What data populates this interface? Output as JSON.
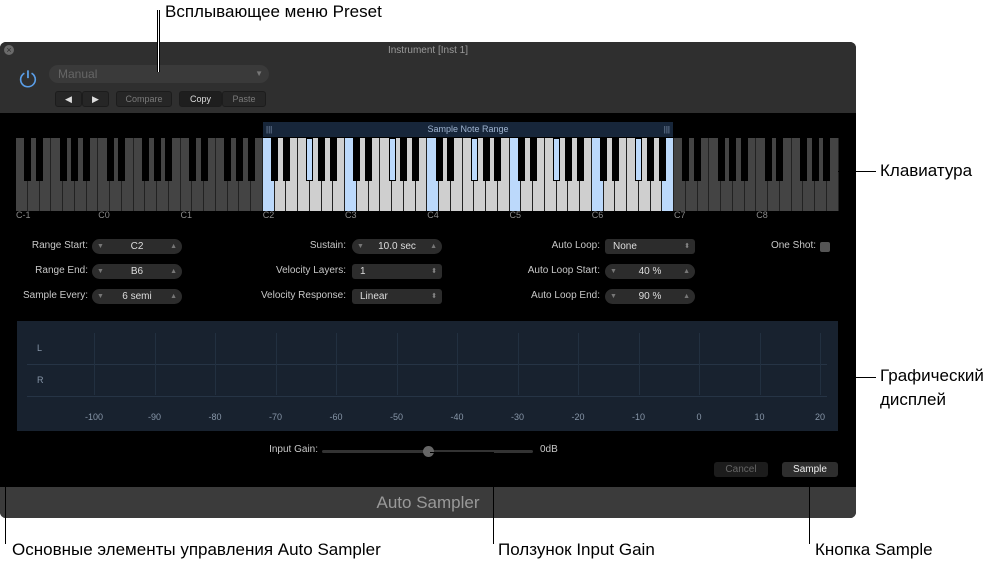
{
  "window": {
    "title": "Instrument [Inst 1]",
    "footer": "Auto Sampler"
  },
  "toolbar": {
    "preset": "Manual",
    "prev": "◀",
    "next": "▶",
    "compare": "Compare",
    "copy": "Copy",
    "paste": "Paste"
  },
  "keyboard": {
    "range_label": "Sample Note Range",
    "octaves": [
      "C-1",
      "C0",
      "C1",
      "C2",
      "C3",
      "C4",
      "C5",
      "C6",
      "C7",
      "C8"
    ],
    "highlighted_notes": [
      "C2",
      "F#2",
      "C3",
      "F#3",
      "C4",
      "F#4",
      "C5",
      "F#5",
      "C6",
      "F#6",
      "B6"
    ],
    "highlight_color": "#bcd9fb"
  },
  "controls": {
    "range_start": {
      "label": "Range Start:",
      "value": "C2"
    },
    "range_end": {
      "label": "Range End:",
      "value": "B6"
    },
    "sample_every": {
      "label": "Sample Every:",
      "value": "6 semi"
    },
    "sustain": {
      "label": "Sustain:",
      "value": "10.0 sec"
    },
    "velocity_layers": {
      "label": "Velocity Layers:",
      "value": "1"
    },
    "velocity_response": {
      "label": "Velocity Response:",
      "value": "Linear"
    },
    "auto_loop": {
      "label": "Auto Loop:",
      "value": "None"
    },
    "auto_loop_start": {
      "label": "Auto Loop Start:",
      "value": "40 %"
    },
    "auto_loop_end": {
      "label": "Auto Loop End:",
      "value": "90 %"
    },
    "one_shot": {
      "label": "One Shot:",
      "checked": false
    }
  },
  "meter": {
    "channels": [
      "L",
      "R"
    ],
    "ticks": [
      "-100",
      "-90",
      "-80",
      "-70",
      "-60",
      "-50",
      "-40",
      "-30",
      "-20",
      "-10",
      "0",
      "10",
      "20"
    ]
  },
  "input_gain": {
    "label": "Input Gain:",
    "value": "0dB",
    "position_fraction": 0.5
  },
  "buttons": {
    "cancel": "Cancel",
    "sample": "Sample"
  },
  "annotations": {
    "preset": "Всплывающее меню Preset",
    "keyboard": "Клавиатура",
    "display_1": "Графический",
    "display_2": "дисплей",
    "controls": "Основные элементы управления Auto Sampler",
    "slider": "Ползунок Input Gain",
    "sample": "Кнопка Sample"
  }
}
